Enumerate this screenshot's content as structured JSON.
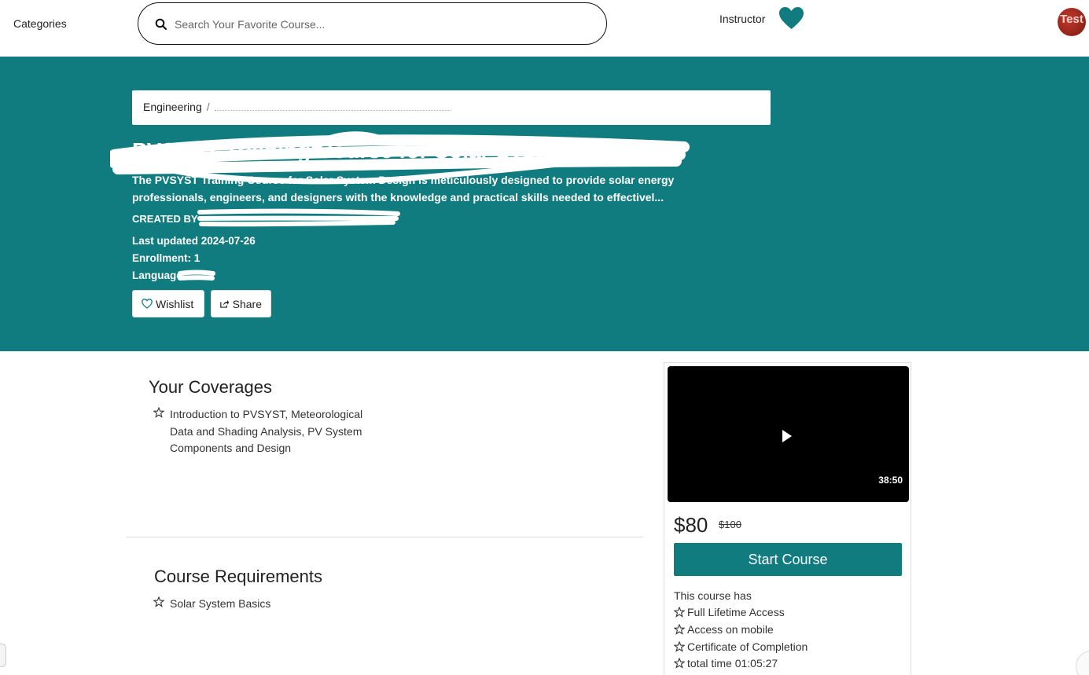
{
  "nav": {
    "categories_label": "Categories",
    "search_placeholder": "Search Your Favorite Course...",
    "instructor_label": "Instructor",
    "avatar_text": "Test",
    "accent_color": "#117c7f"
  },
  "hero": {
    "breadcrumb_root": "Engineering",
    "breadcrumb_sep": "/",
    "title": "PVSYST Training Course for Solar System Design",
    "description": "The PVSYST Training Course for Solar System Design is meticulously designed to provide solar energy professionals, engineers, and designers with the knowledge and practical skills needed to effectivel...",
    "created_by_label": "CREATED BY",
    "last_updated": "Last updated 2024-07-26",
    "enrollment": "Enrollment: 1",
    "language_label": "Language:",
    "wishlist_label": "Wishlist",
    "share_label": "Share"
  },
  "coverages": {
    "title": "Your Coverages",
    "items": [
      "Introduction to PVSYST, Meteorological Data and Shading Analysis, PV System Components and Design"
    ]
  },
  "requirements": {
    "title": "Course Requirements",
    "items": [
      "Solar System Basics"
    ]
  },
  "card": {
    "duration": "38:50",
    "price": "$80",
    "old_price": "$100",
    "start_label": "Start Course",
    "has_title": "This course has",
    "features": [
      "Full Lifetime Access",
      "Access on mobile",
      "Certificate of Completion",
      "total time 01:05:27"
    ]
  }
}
